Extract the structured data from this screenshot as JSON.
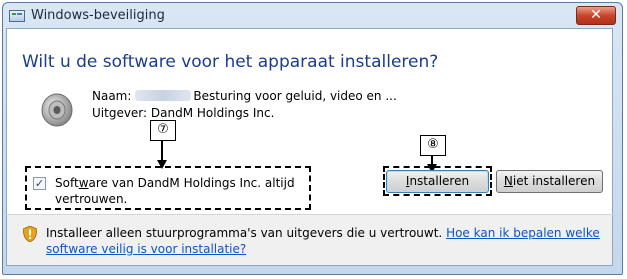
{
  "window": {
    "title": "Windows-beveiliging",
    "close_label": "✕"
  },
  "dialog": {
    "heading": "Wilt u de software voor het apparaat installeren?",
    "name_label": "Naam:",
    "name_value": "Besturing voor geluid, video en ...",
    "publisher_label": "Uitgever:",
    "publisher_value": "DandM Holdings Inc."
  },
  "trust_checkbox": {
    "checked": true,
    "label_part1": "Soft",
    "label_mnemonic": "w",
    "label_part2": "are van DandM Holdings Inc. altijd vertrouwen."
  },
  "buttons": {
    "install_mnemonic": "I",
    "install_rest": "nstalleren",
    "noinstall_mnemonic": "N",
    "noinstall_rest": "iet installeren"
  },
  "footer": {
    "text": "Installeer alleen stuurprogramma's van uitgevers die u vertrouwt.",
    "link": "Hoe kan ik bepalen welke software veilig is voor installatie?"
  },
  "callouts": {
    "seven": "⑦",
    "eight": "⑧"
  },
  "colors": {
    "heading": "#1a3e8c",
    "link": "#0b54c9",
    "close_button": "#c8452a"
  },
  "icons": [
    "window-icon",
    "close-icon",
    "speaker-icon",
    "shield-warning-icon",
    "checkmark-icon"
  ]
}
